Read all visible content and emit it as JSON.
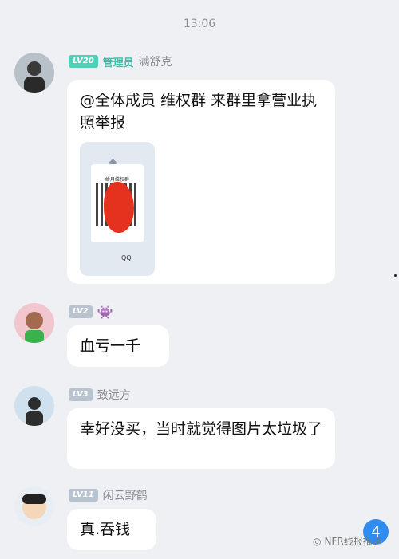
{
  "timestamp": "13:06",
  "messages": [
    {
      "level": "LV20",
      "role": "管理员",
      "name": "满舒克",
      "text": "@全体成员 维权群 来群里拿营业执照举报",
      "attachment": {
        "title": "给月维权群",
        "logo": "QQ"
      }
    },
    {
      "level": "LV2",
      "name": "",
      "text": "血亏一千"
    },
    {
      "level": "LV3",
      "name": "致远方",
      "text": "幸好没买，当时就觉得图片太垃圾了"
    },
    {
      "level": "LV11",
      "name": "闲云野鹤",
      "text": "真.吞钱"
    }
  ],
  "unread_badge": "4",
  "watermark": "NFR线报推送",
  "colors": {
    "background": "#eef0f4",
    "admin_accent": "#36c2a6",
    "badge": "#2f8cf2"
  }
}
